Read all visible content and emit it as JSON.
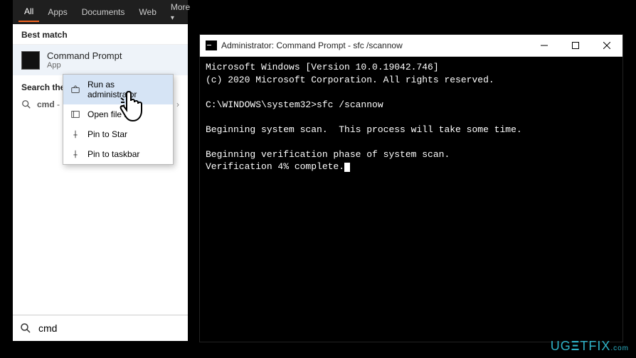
{
  "tabs": {
    "all": "All",
    "apps": "Apps",
    "documents": "Documents",
    "web": "Web",
    "more": "More"
  },
  "best_match_label": "Best match",
  "match": {
    "title": "Command Prompt",
    "sub": "App"
  },
  "search_web_label": "Search the web",
  "search_web_row": {
    "query": "cmd",
    "suffix": "- See"
  },
  "context": {
    "run_admin": "Run as administrator",
    "open_loc": "Open file lo",
    "pin_start": "Pin to Star",
    "pin_task": "Pin to taskbar"
  },
  "searchbox": {
    "value": "cmd"
  },
  "cmd": {
    "title": "Administrator: Command Prompt - sfc  /scannow",
    "line1": "Microsoft Windows [Version 10.0.19042.746]",
    "line2": "(c) 2020 Microsoft Corporation. All rights reserved.",
    "prompt": "C:\\WINDOWS\\system32>sfc /scannow",
    "scan1": "Beginning system scan.  This process will take some time.",
    "scan2": "Beginning verification phase of system scan.",
    "scan3": "Verification 4% complete."
  },
  "watermark": "UG    TFIX"
}
